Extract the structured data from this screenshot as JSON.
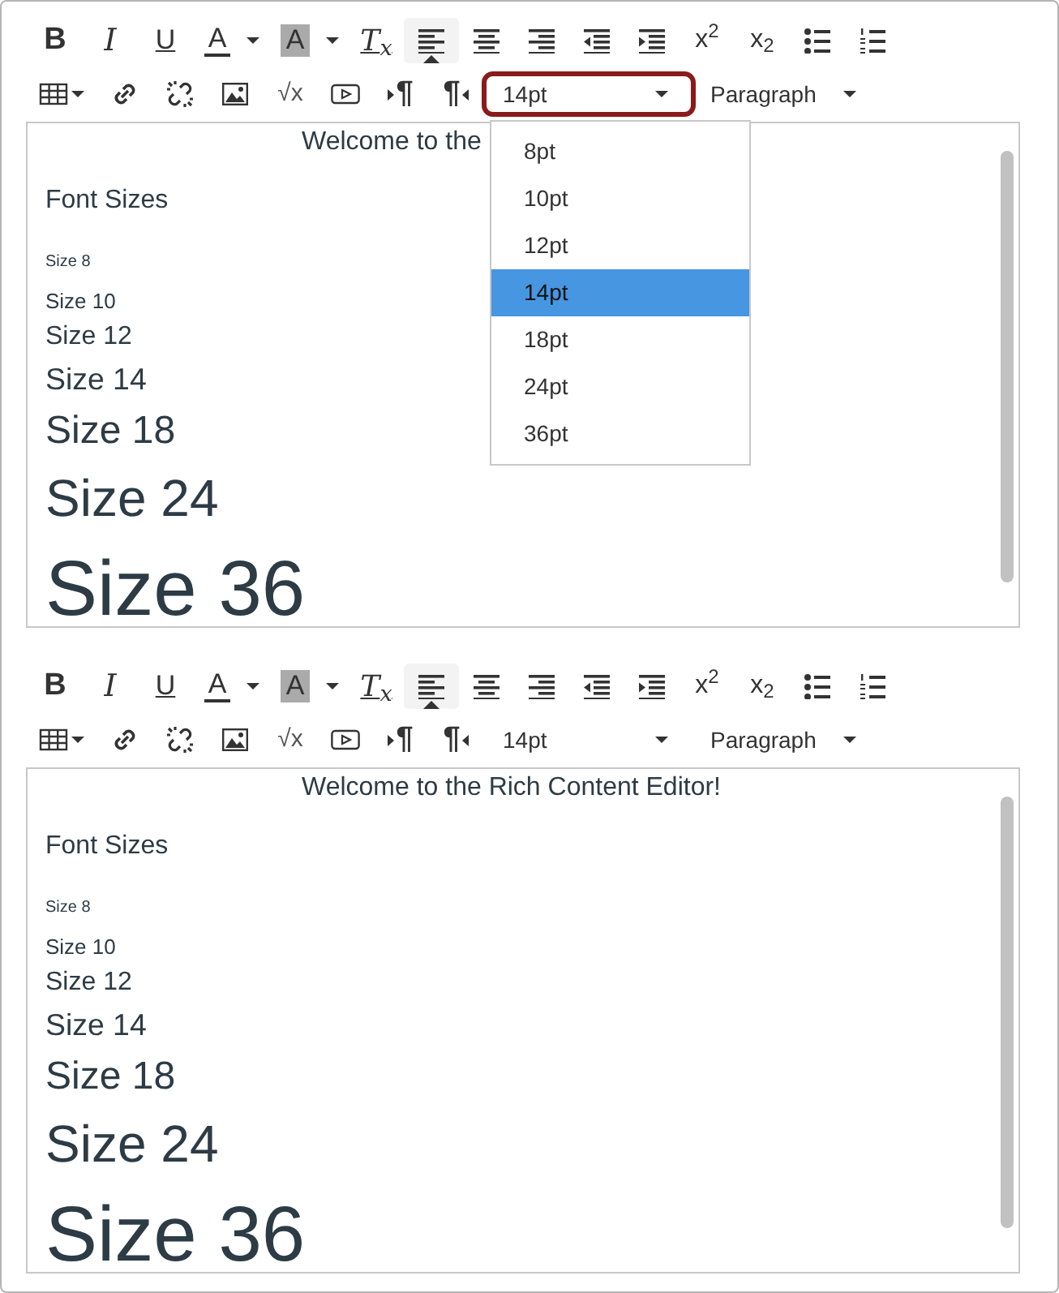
{
  "editors": [
    {
      "toolbar": {
        "row_1": [
          {
            "kind": "bold",
            "label": "B"
          },
          {
            "kind": "italic",
            "label": "I"
          },
          {
            "kind": "underline",
            "label": "U"
          },
          {
            "kind": "textcolor",
            "label": "A"
          },
          {
            "kind": "highlight",
            "label": "A"
          },
          {
            "kind": "clear",
            "label": "T$_{x}$"
          },
          {
            "kind": "align-left",
            "selected": true
          },
          {
            "kind": "align-center",
            "selected": false
          },
          {
            "kind": "align-right",
            "selected": false
          },
          {
            "kind": "outdent"
          },
          {
            "kind": "indent"
          },
          {
            "kind": "superscript",
            "label": "x$^{2}$"
          },
          {
            "kind": "subscript",
            "label": "x$_{2}$"
          },
          {
            "kind": "bullets"
          },
          {
            "kind": "numbers"
          }
        ],
        "row_2": [
          {
            "kind": "table"
          },
          {
            "kind": "link"
          },
          {
            "kind": "unlink"
          },
          {
            "kind": "image"
          },
          {
            "kind": "equation",
            "label": "√x"
          },
          {
            "kind": "media"
          },
          {
            "kind": "ltr",
            "label": "¶"
          },
          {
            "kind": "rtl",
            "label": "¶"
          }
        ],
        "font_size": {
          "value": "14pt",
          "highlighted": true,
          "open": true,
          "options": [
            {
              "label": "8pt",
              "selected": false
            },
            {
              "label": "10pt",
              "selected": false
            },
            {
              "label": "12pt",
              "selected": false
            },
            {
              "label": "14pt",
              "selected": true
            },
            {
              "label": "18pt",
              "selected": false
            },
            {
              "label": "24pt",
              "selected": false
            },
            {
              "label": "36pt",
              "selected": false
            }
          ]
        },
        "block_format": {
          "value": "Paragraph"
        }
      },
      "content": {
        "heading": "Welcome to the",
        "lines": [
          "Font Sizes",
          "Size 8",
          "Size 10",
          "Size 12",
          "Size 14",
          "Size 18",
          "Size 24",
          "Size 36"
        ]
      }
    },
    {
      "toolbar": {
        "row_1": [
          {
            "kind": "bold",
            "label": "B"
          },
          {
            "kind": "italic",
            "label": "I"
          },
          {
            "kind": "underline",
            "label": "U"
          },
          {
            "kind": "textcolor",
            "label": "A"
          },
          {
            "kind": "highlight",
            "label": "A"
          },
          {
            "kind": "clear",
            "label": "T$_{x}$"
          },
          {
            "kind": "align-left",
            "selected": true
          },
          {
            "kind": "align-center",
            "selected": false
          },
          {
            "kind": "align-right",
            "selected": false
          },
          {
            "kind": "outdent"
          },
          {
            "kind": "indent"
          },
          {
            "kind": "superscript",
            "label": "x$^{2}$"
          },
          {
            "kind": "subscript",
            "label": "x$_{2}$"
          },
          {
            "kind": "bullets"
          },
          {
            "kind": "numbers"
          }
        ],
        "row_2": [
          {
            "kind": "table"
          },
          {
            "kind": "link"
          },
          {
            "kind": "unlink"
          },
          {
            "kind": "image"
          },
          {
            "kind": "equation",
            "label": "√x"
          },
          {
            "kind": "media"
          },
          {
            "kind": "ltr",
            "label": "¶"
          },
          {
            "kind": "rtl",
            "label": "¶"
          }
        ],
        "font_size": {
          "value": "14pt",
          "highlighted": false,
          "open": false
        },
        "block_format": {
          "value": "Paragraph"
        }
      },
      "content": {
        "heading": "Welcome to the Rich Content Editor!",
        "lines": [
          "Font Sizes",
          "Size 8",
          "Size 10",
          "Size 12",
          "Size 14",
          "Size 18",
          "Size 24",
          "Size 36"
        ]
      }
    }
  ]
}
